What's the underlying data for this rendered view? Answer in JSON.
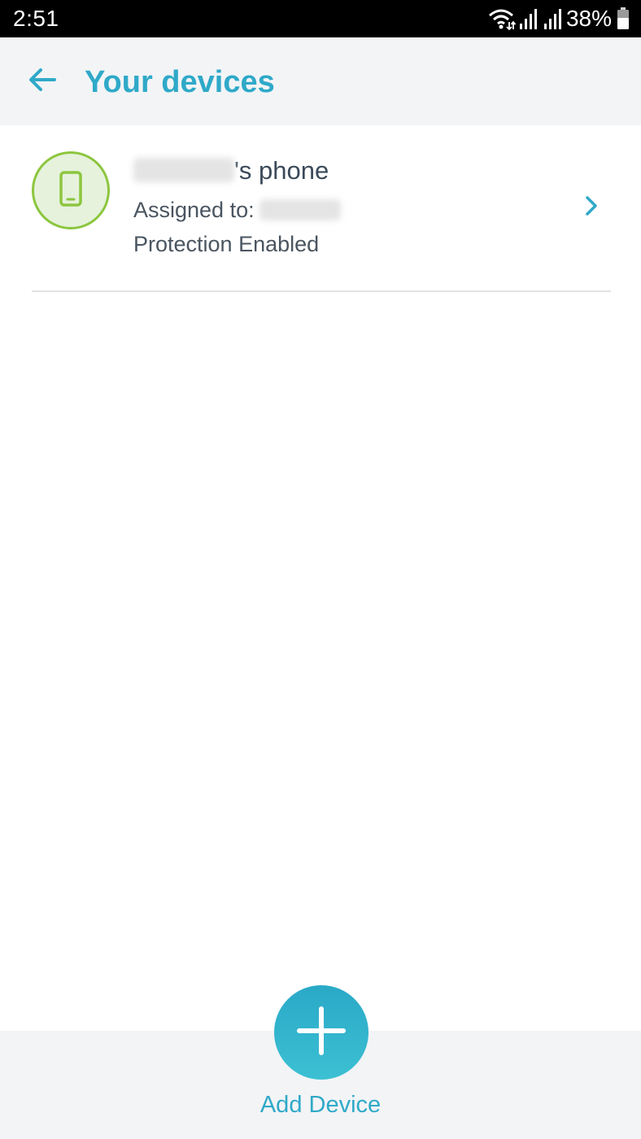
{
  "status_bar": {
    "time": "2:51",
    "battery_percent": "38%",
    "icons": [
      "wifi-icon",
      "signal-icon",
      "signal-icon",
      "battery-icon"
    ]
  },
  "app_bar": {
    "back_icon": "arrow-left-icon",
    "title": "Your devices"
  },
  "devices": [
    {
      "icon": "smartphone-icon",
      "name_suffix": "'s phone",
      "assigned_label": "Assigned to:",
      "status": "Protection Enabled",
      "chevron_icon": "chevron-right-icon"
    }
  ],
  "bottom": {
    "add_icon": "plus-icon",
    "add_label": "Add Device"
  },
  "colors": {
    "accent": "#2fa9c8",
    "status_green": "#8cc63f",
    "bar_background": "#f3f4f6"
  }
}
